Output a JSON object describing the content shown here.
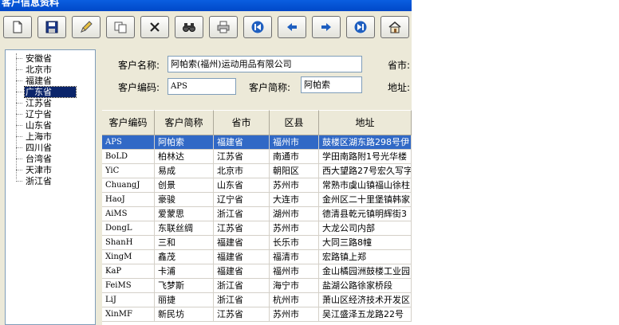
{
  "window": {
    "title": "客户信息资料"
  },
  "tree": {
    "items": [
      "安徽省",
      "北京市",
      "福建省",
      "广东省",
      "江苏省",
      "辽宁省",
      "山东省",
      "上海市",
      "四川省",
      "台湾省",
      "天津市",
      "浙江省"
    ],
    "selected_index": 3
  },
  "form": {
    "name_label": "客户名称:",
    "name_value": "阿帕索(福州)运动用品有限公司",
    "code_label": "客户编码:",
    "code_value": "APS",
    "short_label": "客户简称:",
    "short_value": "阿帕索",
    "province_label": "省市:",
    "address_label": "地址:"
  },
  "grid": {
    "columns": [
      "客户编码",
      "客户简称",
      "省市",
      "区县",
      "地址"
    ],
    "rows": [
      [
        "APS",
        "阿帕索",
        "福建省",
        "福州市",
        "鼓楼区湖东路298号伊"
      ],
      [
        "BoLD",
        "柏林达",
        "江苏省",
        "南通市",
        "学田南路附1号光华楼"
      ],
      [
        "YiC",
        "易成",
        "北京市",
        "朝阳区",
        "西大望路27号宏久写字"
      ],
      [
        "ChuangJ",
        "创景",
        "山东省",
        "苏州市",
        "常熟市虞山镇福山徐柱"
      ],
      [
        "HaoJ",
        "豪骏",
        "辽宁省",
        "大连市",
        "金州区二十里堡镇韩家"
      ],
      [
        "AiMS",
        "爱蒙思",
        "浙江省",
        "湖州市",
        "德清县乾元镇明辉街3"
      ],
      [
        "DongL",
        "东联丝绸",
        "江苏省",
        "苏州市",
        "大龙公司内部"
      ],
      [
        "ShanH",
        "三和",
        "福建省",
        "长乐市",
        "大同三路8幢"
      ],
      [
        "XingM",
        "鑫茂",
        "福建省",
        "福清市",
        "宏路镇上郑"
      ],
      [
        "KaP",
        "卡浦",
        "福建省",
        "福州市",
        "金山橘园洲鼓楼工业园"
      ],
      [
        "FeiMS",
        "飞梦斯",
        "浙江省",
        "海宁市",
        "盐湖公路徐家桥段"
      ],
      [
        "LiJ",
        "丽捷",
        "浙江省",
        "杭州市",
        "萧山区经济技术开发区"
      ],
      [
        "XinMF",
        "新民坊",
        "江苏省",
        "苏州市",
        "吴江盛泽五龙路22号"
      ]
    ],
    "selected_row": 0
  },
  "colors": {
    "title_bar": "#0a5ee0",
    "selection": "#3169c6",
    "tree_selection": "#0a246a",
    "face": "#ece9d8"
  }
}
